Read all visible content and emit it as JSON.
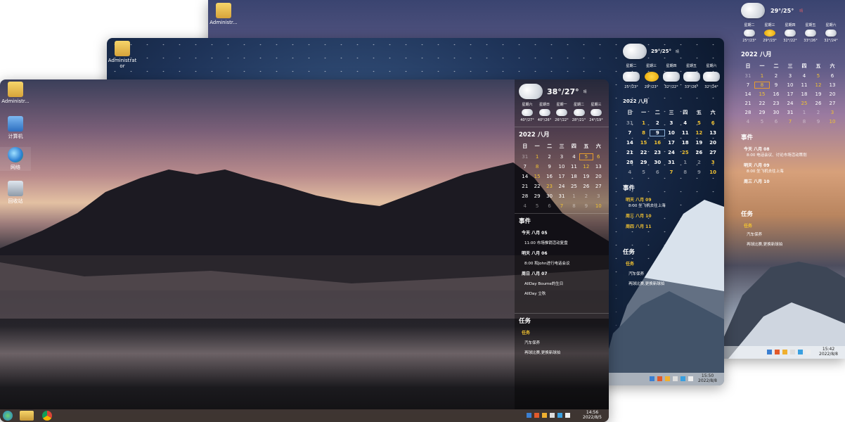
{
  "back_screen": {
    "desktop_icon": "Administr...",
    "weather": {
      "temp": "29°/25°",
      "condition": "晴"
    },
    "days": [
      {
        "name": "星期二",
        "temp": "25°/23°"
      },
      {
        "name": "星期三",
        "temp": "29°/23°"
      },
      {
        "name": "星期四",
        "temp": "32°/22°"
      },
      {
        "name": "星期五",
        "temp": "33°/26°"
      },
      {
        "name": "星期六",
        "temp": "32°/24°"
      }
    ],
    "calendar_header": "2022  八月",
    "events_title": "事件",
    "events": [
      {
        "head": "今天 八月 08",
        "item": "8:00 电话会议、讨论市场活动策划"
      },
      {
        "head": "明天 八月 09",
        "item": "8:00 坐飞机去往上海"
      },
      {
        "head": "周三 八月 10",
        "item": ""
      }
    ],
    "tasks_title": "任务",
    "tasks_group": "任务",
    "tasks": [
      "汽车保养",
      "再球比赛,更换新球拍"
    ],
    "clock_time": "15:42",
    "clock_date": "2022/8/8"
  },
  "middle_screen": {
    "desktop_icon": "Administrat or",
    "weather": {
      "temp": "29°/25°",
      "condition": "晴"
    },
    "day_names": [
      "星期二",
      "星期三",
      "星期四",
      "星期五",
      "星期六"
    ],
    "day_temps": [
      "25°/23°",
      "29°/23°",
      "32°/22°",
      "33°/26°",
      "32°/24°"
    ],
    "calendar_header": "2022    八月",
    "events_title": "事件",
    "events": [
      {
        "head": "明天 八月 09",
        "item": "8:00 坐飞机去往上海"
      },
      {
        "head": "周三 八月 10",
        "item": ""
      },
      {
        "head": "周四 八月 11",
        "item": ""
      }
    ],
    "tasks_title": "任务",
    "tasks_group": "任务",
    "tasks": [
      "汽车保养",
      "再球比赛,更换新球拍"
    ],
    "clock_time": "15:50",
    "clock_date": "2022/8/8"
  },
  "front_screen": {
    "desktop_icons": [
      "Administr...",
      "计算机",
      "网络",
      "回收站"
    ],
    "weather": {
      "temp": "38°/27°",
      "condition": "晴"
    },
    "days": [
      {
        "name": "星期六",
        "temp": "40°/27°"
      },
      {
        "name": "星期日",
        "temp": "40°/26°"
      },
      {
        "name": "星期一",
        "temp": "26°/22°"
      },
      {
        "name": "星期二",
        "temp": "28°/21°"
      },
      {
        "name": "星期三",
        "temp": "24°/19°"
      }
    ],
    "calendar_header": "2022      八月",
    "weekdays": [
      "日",
      "一",
      "二",
      "三",
      "四",
      "五",
      "六"
    ],
    "calendar_rows": [
      [
        "31",
        "1",
        "2",
        "3",
        "4",
        "5",
        "6"
      ],
      [
        "7",
        "8",
        "9",
        "10",
        "11",
        "12",
        "13"
      ],
      [
        "14",
        "15",
        "16",
        "17",
        "18",
        "19",
        "20"
      ],
      [
        "21",
        "22",
        "23",
        "24",
        "25",
        "26",
        "27"
      ],
      [
        "28",
        "29",
        "30",
        "31",
        "1",
        "2",
        "3"
      ],
      [
        "4",
        "5",
        "6",
        "7",
        "8",
        "9",
        "10"
      ]
    ],
    "events_title": "事件",
    "events": [
      {
        "head": "今天 八月 05",
        "items": [
          "11:00 市场推销活动复盘"
        ]
      },
      {
        "head": "明天 八月 06",
        "items": [
          "8:00 和John进行电话会议"
        ]
      },
      {
        "head": "周日 八月 07",
        "items": [
          "AllDay Boume的生日",
          "AllDay 立秋"
        ]
      }
    ],
    "tasks_title": "任务",
    "tasks_group": "任务",
    "tasks": [
      "汽车保养",
      "再球比赛,更换新球拍"
    ],
    "clock_time": "14:56",
    "clock_date": "2022/8/5"
  },
  "colors": {
    "accent_yellow": "#f1c232",
    "today_ring": "#e89b2e",
    "taskbar": "#463c37"
  }
}
